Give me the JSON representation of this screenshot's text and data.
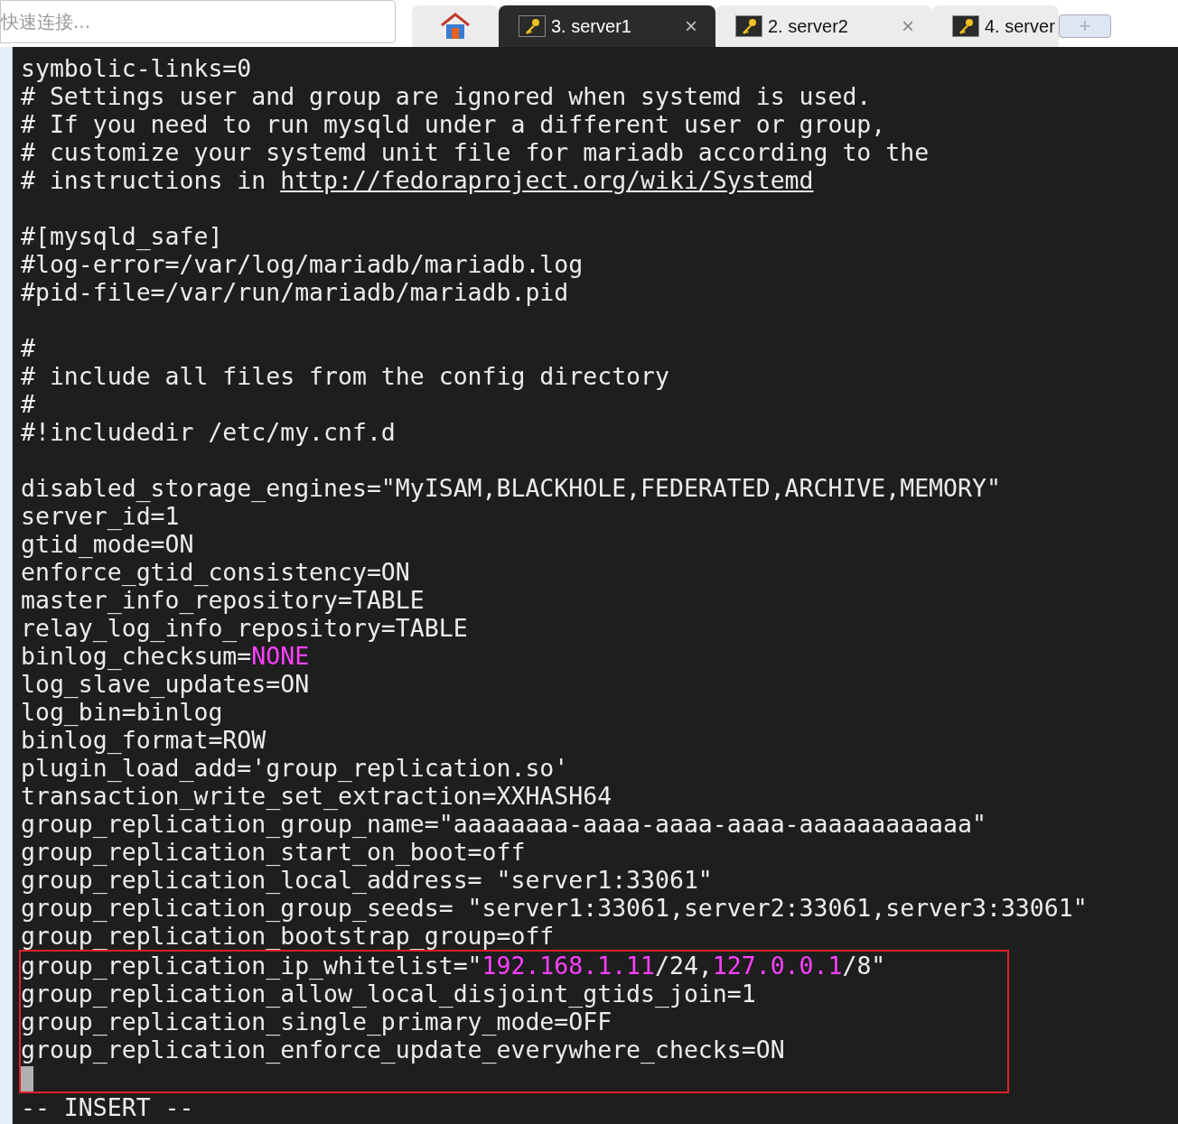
{
  "quick_connect": {
    "placeholder": "快速连接..."
  },
  "tabs": [
    {
      "kind": "home",
      "selected": false
    },
    {
      "kind": "session",
      "label": "3. server1",
      "selected": true,
      "close": "×"
    },
    {
      "kind": "session",
      "label": "2. server2",
      "selected": false,
      "close": "×"
    },
    {
      "kind": "session",
      "label": "4. server",
      "selected": false
    }
  ],
  "new_tab": {
    "label": "+"
  },
  "editor": {
    "lines": [
      {
        "segments": [
          {
            "kind": "plain",
            "text": "symbolic-links=0"
          }
        ]
      },
      {
        "segments": [
          {
            "kind": "plain",
            "text": "# Settings user and group are ignored when systemd is used."
          }
        ]
      },
      {
        "segments": [
          {
            "kind": "plain",
            "text": "# If you need to run mysqld under a different user or group,"
          }
        ]
      },
      {
        "segments": [
          {
            "kind": "plain",
            "text": "# customize your systemd unit file for mariadb according to the"
          }
        ]
      },
      {
        "segments": [
          {
            "kind": "plain",
            "text": "# instructions in "
          },
          {
            "kind": "link",
            "text": "http://fedoraproject.org/wiki/Systemd"
          }
        ]
      },
      {
        "kind": "blank"
      },
      {
        "segments": [
          {
            "kind": "plain",
            "text": "#[mysqld_safe]"
          }
        ]
      },
      {
        "segments": [
          {
            "kind": "plain",
            "text": "#log-error=/var/log/mariadb/mariadb.log"
          }
        ]
      },
      {
        "segments": [
          {
            "kind": "plain",
            "text": "#pid-file=/var/run/mariadb/mariadb.pid"
          }
        ]
      },
      {
        "kind": "blank"
      },
      {
        "segments": [
          {
            "kind": "plain",
            "text": "#"
          }
        ]
      },
      {
        "segments": [
          {
            "kind": "plain",
            "text": "# include all files from the config directory"
          }
        ]
      },
      {
        "segments": [
          {
            "kind": "plain",
            "text": "#"
          }
        ]
      },
      {
        "segments": [
          {
            "kind": "plain",
            "text": "#!includedir /etc/my.cnf.d"
          }
        ]
      },
      {
        "kind": "blank"
      },
      {
        "segments": [
          {
            "kind": "plain",
            "text": "disabled_storage_engines=\"MyISAM,BLACKHOLE,FEDERATED,ARCHIVE,MEMORY\""
          }
        ]
      },
      {
        "segments": [
          {
            "kind": "plain",
            "text": "server_id=1"
          }
        ]
      },
      {
        "segments": [
          {
            "kind": "plain",
            "text": "gtid_mode=ON"
          }
        ]
      },
      {
        "segments": [
          {
            "kind": "plain",
            "text": "enforce_gtid_consistency=ON"
          }
        ]
      },
      {
        "segments": [
          {
            "kind": "plain",
            "text": "master_info_repository=TABLE"
          }
        ]
      },
      {
        "segments": [
          {
            "kind": "plain",
            "text": "relay_log_info_repository=TABLE"
          }
        ]
      },
      {
        "segments": [
          {
            "kind": "plain",
            "text": "binlog_checksum="
          },
          {
            "kind": "constant",
            "text": "NONE"
          }
        ]
      },
      {
        "segments": [
          {
            "kind": "plain",
            "text": "log_slave_updates=ON"
          }
        ]
      },
      {
        "segments": [
          {
            "kind": "plain",
            "text": "log_bin=binlog"
          }
        ]
      },
      {
        "segments": [
          {
            "kind": "plain",
            "text": "binlog_format=ROW"
          }
        ]
      },
      {
        "segments": [
          {
            "kind": "plain",
            "text": "plugin_load_add='group_replication.so'"
          }
        ]
      },
      {
        "segments": [
          {
            "kind": "plain",
            "text": "transaction_write_set_extraction=XXHASH64"
          }
        ]
      },
      {
        "segments": [
          {
            "kind": "plain",
            "text": "group_replication_group_name=\"aaaaaaaa-aaaa-aaaa-aaaa-aaaaaaaaaaaa\""
          }
        ]
      },
      {
        "segments": [
          {
            "kind": "plain",
            "text": "group_replication_start_on_boot=off"
          }
        ]
      },
      {
        "segments": [
          {
            "kind": "plain",
            "text": "group_replication_local_address= \"server1:33061\""
          }
        ]
      },
      {
        "segments": [
          {
            "kind": "plain",
            "text": "group_replication_group_seeds= \"server1:33061,server2:33061,server3:33061\""
          }
        ]
      },
      {
        "segments": [
          {
            "kind": "plain",
            "text": "group_replication_bootstrap_group=off"
          }
        ]
      }
    ],
    "highlighted_lines": [
      {
        "segments": [
          {
            "kind": "plain",
            "text": "group_replication_ip_whitelist=\""
          },
          {
            "kind": "constant",
            "text": "192.168.1.11"
          },
          {
            "kind": "plain",
            "text": "/24,"
          },
          {
            "kind": "constant",
            "text": "127.0.0.1"
          },
          {
            "kind": "plain",
            "text": "/8\""
          }
        ]
      },
      {
        "segments": [
          {
            "kind": "plain",
            "text": "group_replication_allow_local_disjoint_gtids_join=1"
          }
        ]
      },
      {
        "segments": [
          {
            "kind": "plain",
            "text": "group_replication_single_primary_mode=OFF"
          }
        ]
      },
      {
        "segments": [
          {
            "kind": "plain",
            "text": "group_replication_enforce_update_everywhere_checks=ON"
          }
        ]
      },
      {
        "kind": "cursor"
      }
    ],
    "mode": "-- INSERT --"
  }
}
